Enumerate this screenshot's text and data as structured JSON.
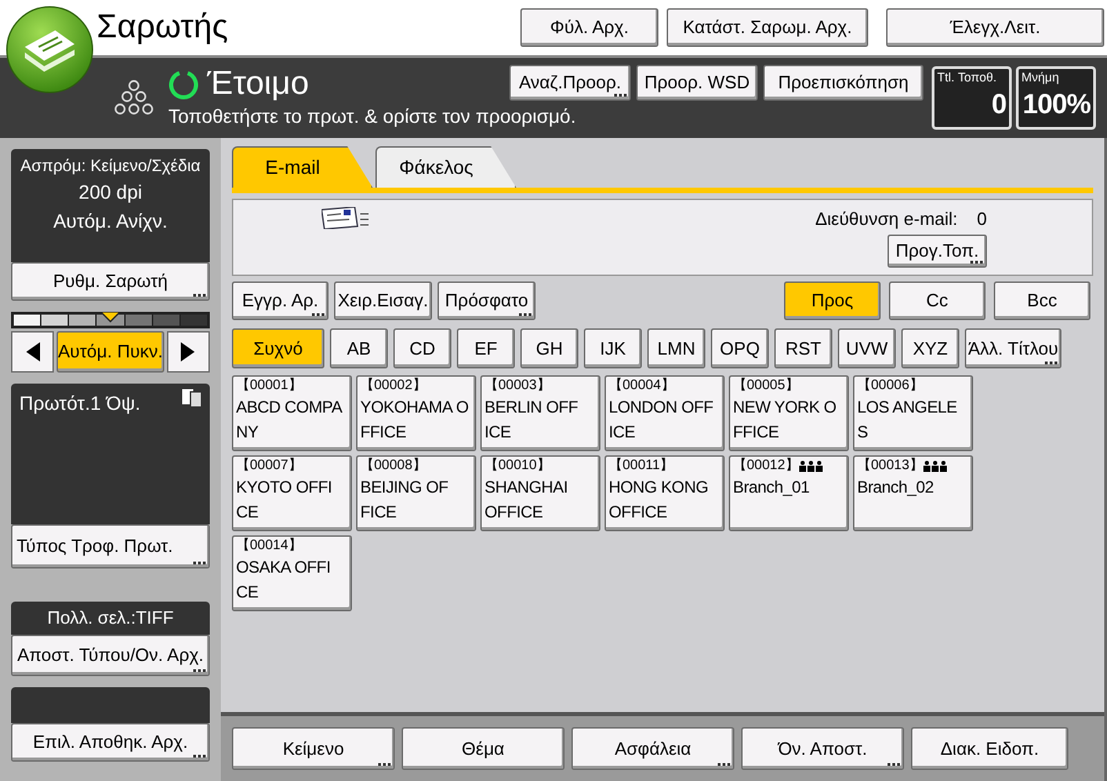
{
  "header": {
    "title": "Σαρωτής",
    "buttons": [
      {
        "label": "Φύλ. Αρχ."
      },
      {
        "label": "Κατάστ. Σαρωμ. Αρχ."
      },
      {
        "label": "Έλεγχ.Λειτ."
      }
    ]
  },
  "status": {
    "text": "Έτοιμο",
    "message": "Τοποθετήστε το πρωτ. & ορίστε τον προορισμό.",
    "buttons": [
      {
        "label": "Αναζ.Προορ.",
        "more": true
      },
      {
        "label": "Προορ. WSD",
        "more": false
      },
      {
        "label": "Προεπισκόπηση",
        "more": false
      }
    ],
    "counters": [
      {
        "label": "Ttl. Τοποθ.",
        "value": "0"
      },
      {
        "label": "Μνήμη",
        "value": "100%"
      }
    ]
  },
  "sidebar": {
    "scan_settings": [
      "Ασπρόμ: Κείμενο/Σχέδια",
      "200 dpi",
      "Αυτόμ. Ανίχν."
    ],
    "scan_button": {
      "label": "Ρυθμ. Σαρωτή",
      "more": true
    },
    "density": {
      "level": 0.5,
      "auto_label": "Αυτόμ. Πυκν.",
      "auto_selected": true
    },
    "original": "Πρωτότ.1 Όψ.",
    "feed_button": {
      "label": "Τύπος Τροφ. Πρωτ.",
      "more": true
    },
    "file_type": "Πολλ. σελ.:TIFF",
    "file_type_button": {
      "label": "Αποστ. Τύπου/Ον. Αρχ.",
      "more": true
    },
    "store_button": {
      "label": "Επιλ. Αποθηκ. Αρχ.",
      "more": true
    }
  },
  "tabs": [
    {
      "label": "E-mail",
      "selected": true
    },
    {
      "label": "Φάκελος",
      "selected": false
    }
  ],
  "destination": {
    "label": "Διεύθυνση e-mail:",
    "count": "0",
    "button": {
      "label": "Προγ.Τοπ.",
      "more": true
    }
  },
  "entry_buttons": [
    {
      "label": "Εγγρ. Αρ.",
      "more": true
    },
    {
      "label": "Χειρ.Εισαγ.",
      "more": false
    },
    {
      "label": "Πρόσφατο",
      "more": true
    }
  ],
  "recipient_types": [
    {
      "label": "Προς",
      "selected": true
    },
    {
      "label": "Cc",
      "selected": false
    },
    {
      "label": "Bcc",
      "selected": false
    }
  ],
  "index_tabs": [
    {
      "label": "Συχνό",
      "selected": true
    },
    {
      "label": "AB",
      "selected": false
    },
    {
      "label": "CD",
      "selected": false
    },
    {
      "label": "EF",
      "selected": false
    },
    {
      "label": "GH",
      "selected": false
    },
    {
      "label": "IJK",
      "selected": false
    },
    {
      "label": "LMN",
      "selected": false
    },
    {
      "label": "OPQ",
      "selected": false
    },
    {
      "label": "RST",
      "selected": false
    },
    {
      "label": "UVW",
      "selected": false
    },
    {
      "label": "XYZ",
      "selected": false
    },
    {
      "label": "Άλλ. Τίτλου",
      "selected": false,
      "more": true
    }
  ],
  "entries": [
    {
      "code": "【00001】",
      "kind": "single",
      "lines": [
        "ABCD COMPA",
        "NY"
      ]
    },
    {
      "code": "【00002】",
      "kind": "single",
      "lines": [
        "YOKOHAMA O",
        "FFICE"
      ]
    },
    {
      "code": "【00003】",
      "kind": "single",
      "lines": [
        "BERLIN OFF",
        "ICE"
      ]
    },
    {
      "code": "【00004】",
      "kind": "single",
      "lines": [
        "LONDON OFF",
        "ICE"
      ]
    },
    {
      "code": "【00005】",
      "kind": "single",
      "lines": [
        "NEW YORK O",
        "FFICE"
      ]
    },
    {
      "code": "【00006】",
      "kind": "single",
      "lines": [
        "LOS ANGELE",
        "S"
      ]
    },
    {
      "code": "【00007】",
      "kind": "single",
      "lines": [
        "KYOTO OFFI",
        "CE"
      ]
    },
    {
      "code": "【00008】",
      "kind": "single",
      "lines": [
        "BEIJING OF",
        "FICE"
      ]
    },
    {
      "code": "【00010】",
      "kind": "single",
      "lines": [
        "SHANGHAI",
        "OFFICE"
      ]
    },
    {
      "code": "【00011】",
      "kind": "single",
      "lines": [
        "HONG KONG",
        "OFFICE"
      ]
    },
    {
      "code": "【00012】",
      "kind": "group",
      "lines": [
        "Branch_01"
      ]
    },
    {
      "code": "【00013】",
      "kind": "group",
      "lines": [
        "Branch_02"
      ]
    },
    {
      "code": "【00014】",
      "kind": "single",
      "lines": [
        "OSAKA OFFI",
        "CE"
      ]
    }
  ],
  "bottom_buttons": [
    {
      "label": "Κείμενο",
      "more": true
    },
    {
      "label": "Θέμα",
      "more": false
    },
    {
      "label": "Ασφάλεια",
      "more": true
    },
    {
      "label": "Όν. Αποστ.",
      "more": true
    },
    {
      "label": "Διακ. Ειδοπ.",
      "more": false
    }
  ]
}
